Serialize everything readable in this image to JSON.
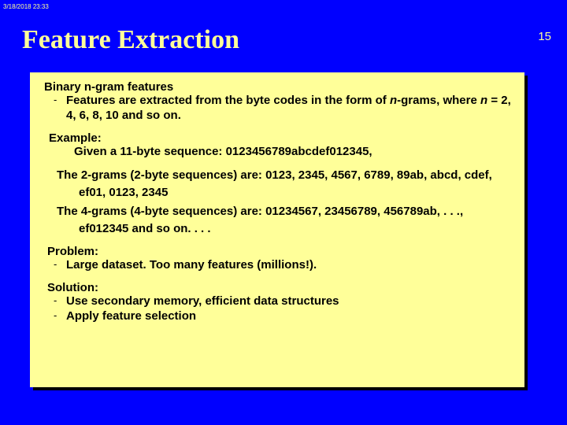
{
  "meta": {
    "timestamp": "3/18/2018 23:33",
    "page_number": "15"
  },
  "title": "Feature Extraction",
  "content": {
    "ngram_heading": "Binary n-gram features",
    "ngram_bullet_pre": "Features are extracted from the byte codes in the form of ",
    "ngram_bullet_it1": "n",
    "ngram_bullet_mid": "-grams,  where ",
    "ngram_bullet_it2": "n",
    "ngram_bullet_post": " = 2, 4, 6, 8, 10 and so on.",
    "example_label": "Example:",
    "example_text": "Given a 11-byte sequence: 0123456789abcdef012345,",
    "twograms": "The 2-grams (2-byte sequences) are: 0123, 2345, 4567, 6789, 89ab, abcd, cdef, ef01, 0123, 2345",
    "fourgrams": "The 4-grams (4-byte sequences) are: 01234567, 23456789, 456789ab, . . ., ef012345 and so on. . . .",
    "problem_label": "Problem:",
    "problem_bullet": "Large dataset. Too many features (millions!).",
    "solution_label": "Solution:",
    "solution_bullet1": "Use secondary memory, efficient data structures",
    "solution_bullet2": "Apply feature selection"
  }
}
